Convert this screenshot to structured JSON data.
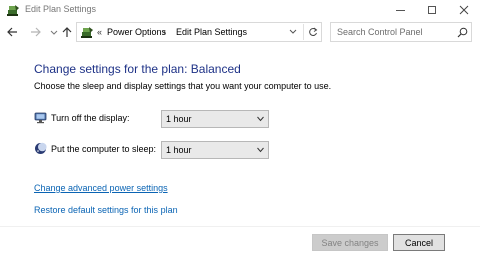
{
  "window": {
    "title": "Edit Plan Settings",
    "minimize_label": "",
    "icons": {
      "app": "power-options-icon",
      "minimize": "minimize-icon",
      "maximize": "maximize-icon",
      "close": "close-icon"
    }
  },
  "nav": {
    "back_icon": "back-arrow-icon",
    "forward_icon": "forward-arrow-icon",
    "recent_icon": "chevron-down-icon",
    "up_icon": "up-arrow-icon"
  },
  "address": {
    "overflow": "«",
    "segments": [
      "Power Options",
      "Edit Plan Settings"
    ],
    "separator": "›",
    "refresh_icon": "refresh-icon"
  },
  "search": {
    "placeholder": "Search Control Panel",
    "icon": "search-icon"
  },
  "main": {
    "heading": "Change settings for the plan: Balanced",
    "description": "Choose the sleep and display settings that you want your computer to use.",
    "settings": [
      {
        "label": "Turn off the display:",
        "value": "1 hour",
        "icon": "display-icon"
      },
      {
        "label": "Put the computer to sleep:",
        "value": "1 hour",
        "icon": "sleep-moon-icon"
      }
    ],
    "links": {
      "advanced": "Change advanced power settings",
      "restore": "Restore default settings for this plan"
    }
  },
  "footer": {
    "save_label": "Save changes",
    "save_enabled": false,
    "cancel_label": "Cancel"
  },
  "colors": {
    "heading": "#1e3287",
    "link": "#0a64b4"
  }
}
